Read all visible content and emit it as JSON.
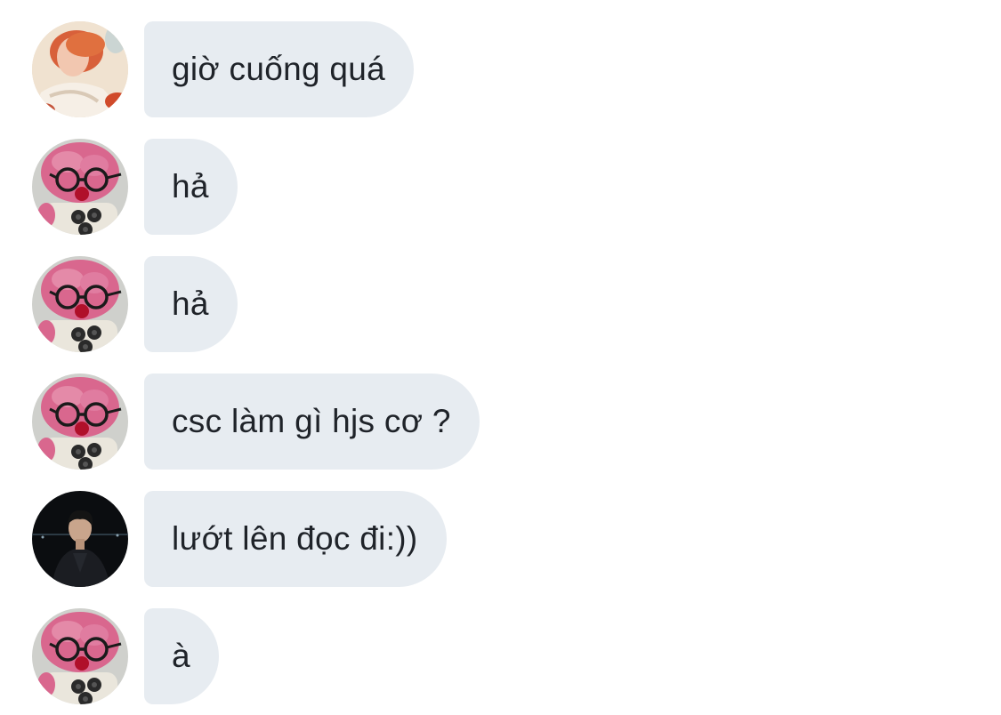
{
  "conversation": {
    "messages": [
      {
        "sender_avatar": "avatar-orange-hair",
        "text": "giờ cuống quá"
      },
      {
        "sender_avatar": "avatar-pink-plush-glasses",
        "text": "hả"
      },
      {
        "sender_avatar": "avatar-pink-plush-glasses",
        "text": "hả"
      },
      {
        "sender_avatar": "avatar-pink-plush-glasses",
        "text": "csc làm gì hjs cơ ?"
      },
      {
        "sender_avatar": "avatar-dark-portrait",
        "text": "lướt lên đọc đi:))"
      },
      {
        "sender_avatar": "avatar-pink-plush-glasses",
        "text": "à"
      }
    ]
  },
  "colors": {
    "bubble_background": "#e7ecf1",
    "message_text": "#1f2329",
    "page_background": "#ffffff"
  }
}
